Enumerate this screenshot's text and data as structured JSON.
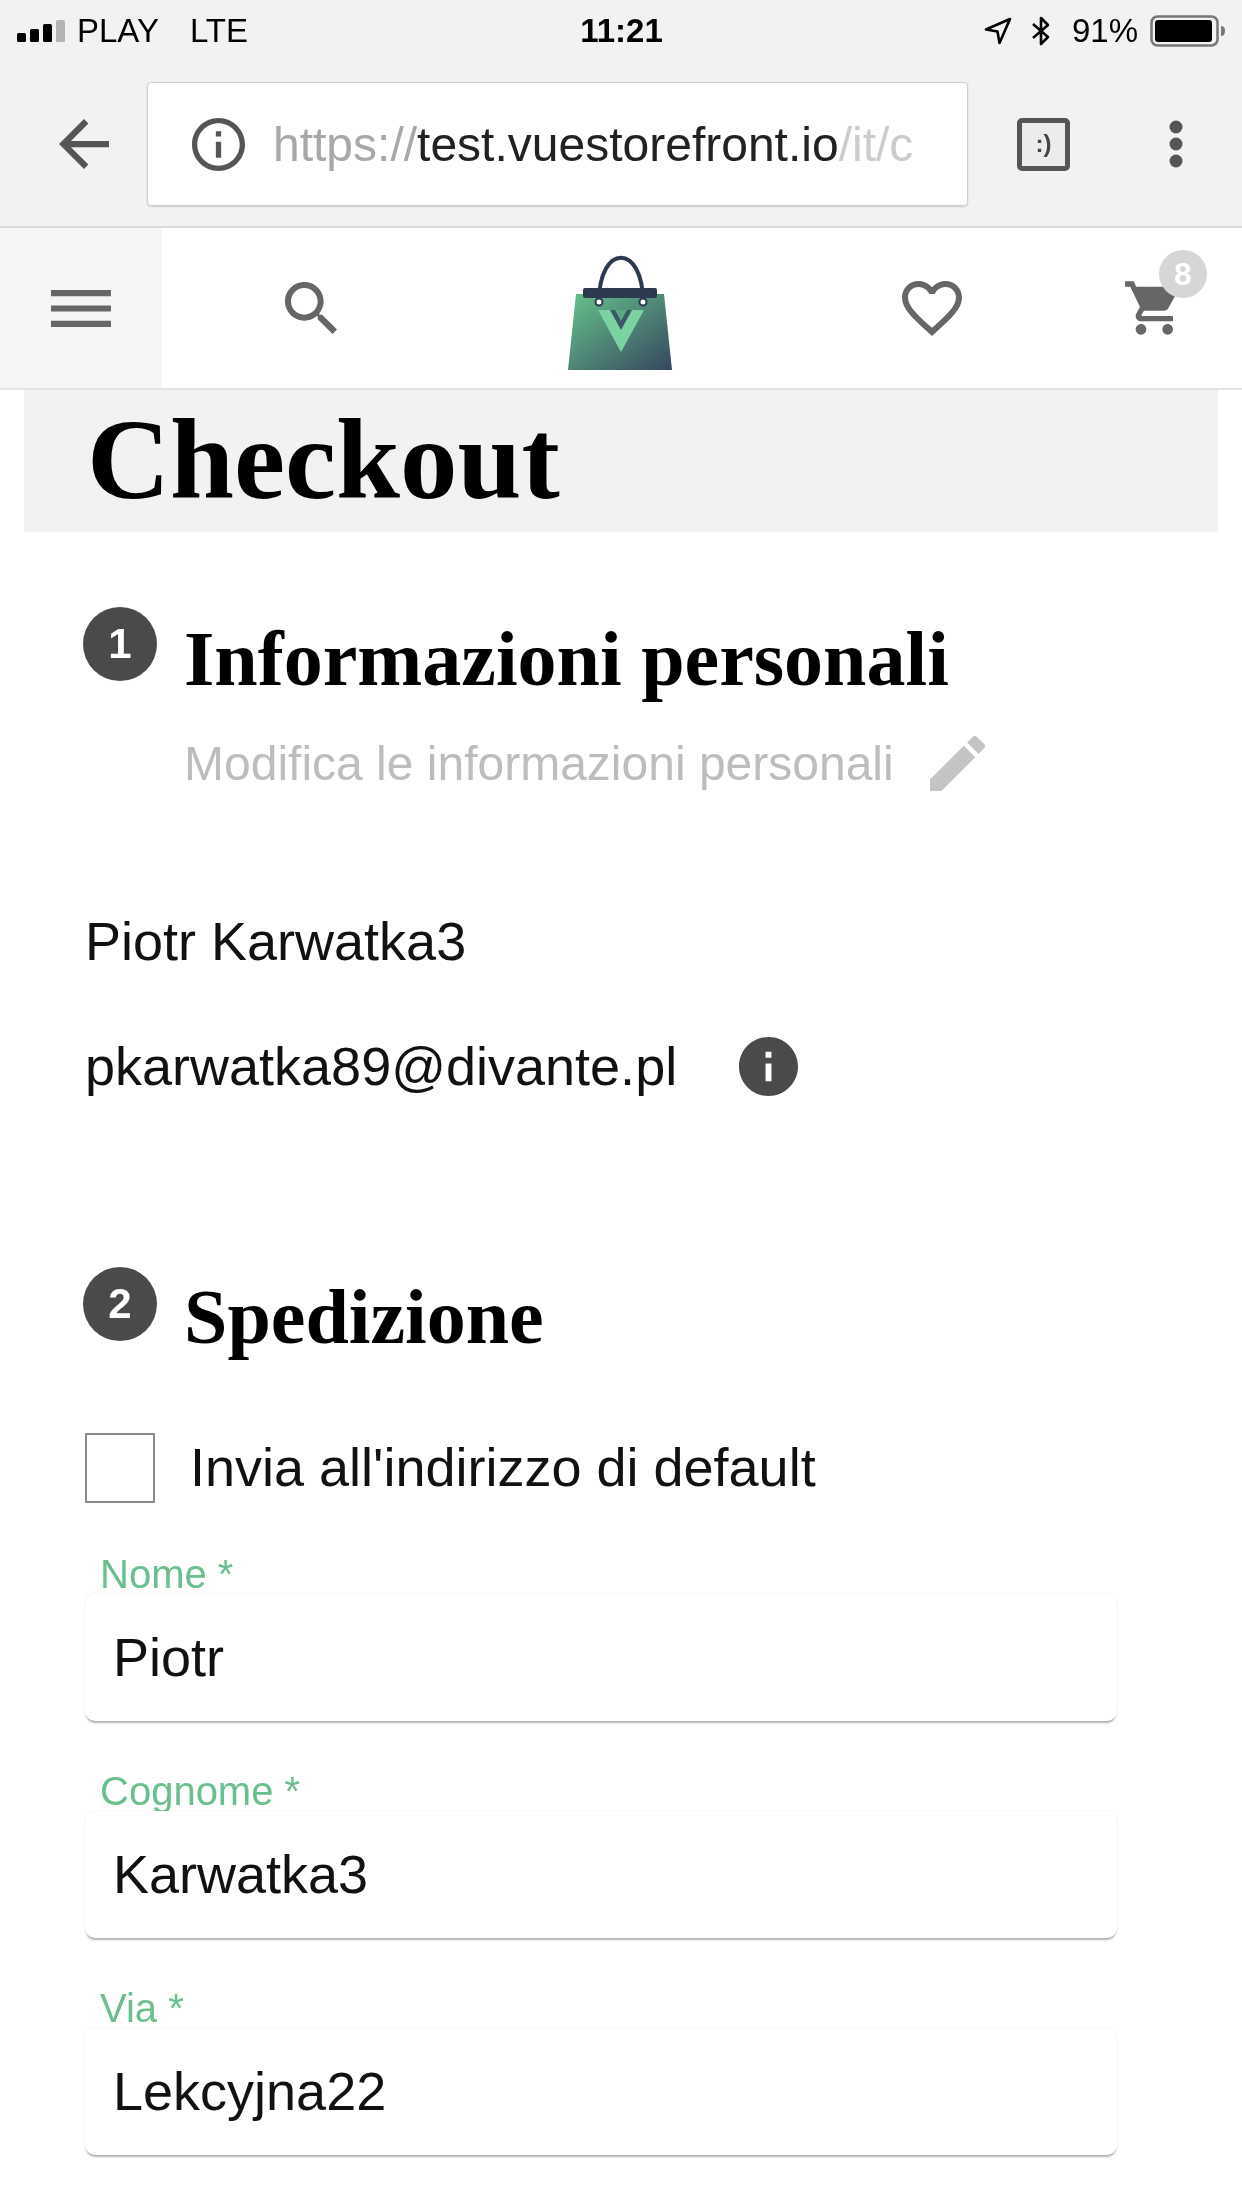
{
  "status_bar": {
    "carrier": "PLAY",
    "network": "LTE",
    "time": "11:21",
    "battery": "91%"
  },
  "browser": {
    "url": {
      "scheme": "https://",
      "host": "test.vuestorefront.io",
      "path": "/it/c"
    },
    "tabs_button": ":)"
  },
  "header": {
    "cart_count": "8"
  },
  "page_title": "Checkout",
  "personal_info": {
    "number": "1",
    "title": "Informazioni personali",
    "edit_link": "Modifica le informazioni personali",
    "name": "Piotr Karwatka3",
    "email": "pkarwatka89@divante.pl"
  },
  "shipping": {
    "number": "2",
    "title": "Spedizione",
    "default_address": {
      "label": "Invia all'indirizzo di default",
      "checked": false
    },
    "fields": [
      {
        "label": "Nome *",
        "value": "Piotr"
      },
      {
        "label": "Cognome *",
        "value": "Karwatka3"
      },
      {
        "label": "Via *",
        "value": "Lekcyjna22"
      }
    ]
  }
}
